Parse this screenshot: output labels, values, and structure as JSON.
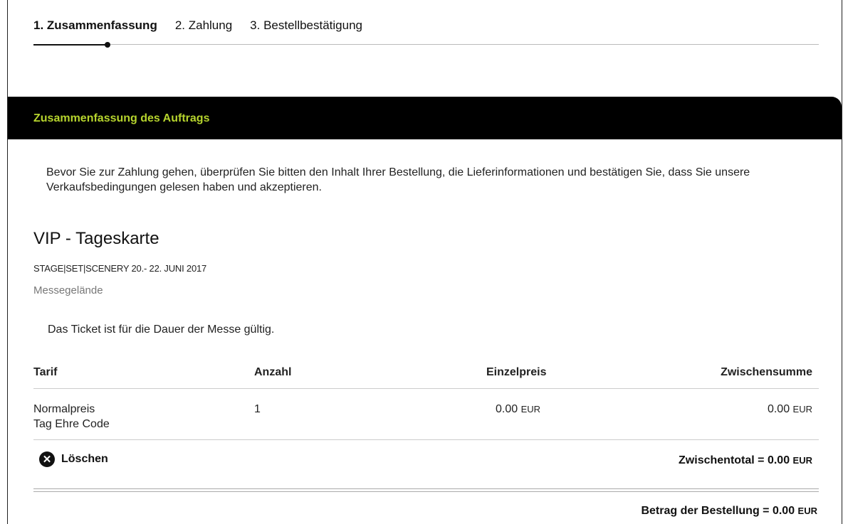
{
  "steps": [
    {
      "label": "1. Zusammenfassung"
    },
    {
      "label": "2. Zahlung"
    },
    {
      "label": "3. Bestellbestätigung"
    }
  ],
  "panel": {
    "title": "Zusammenfassung des Auftrags"
  },
  "intro": "Bevor Sie zur Zahlung gehen, überprüfen Sie bitten den Inhalt Ihrer Bestellung, die Lieferinformationen und bestätigen Sie, dass Sie unsere Verkaufsbedingungen gelesen haben und akzeptieren.",
  "product": {
    "title": "VIP - Tageskarte",
    "event": "STAGE|SET|SCENERY 20.- 22. JUNI 2017",
    "venue": "Messegelände",
    "validity": "Das Ticket ist für die Dauer der Messe gültig."
  },
  "table": {
    "headers": [
      "Tarif",
      "Anzahl",
      "Einzelpreis",
      "Zwischensumme"
    ],
    "row": {
      "tarif_line1": "Normalpreis",
      "tarif_line2": "Tag Ehre Code",
      "anzahl": "1",
      "einzelpreis": "0.00",
      "zwischensumme": "0.00",
      "currency": "EUR"
    }
  },
  "actions": {
    "delete_label": "Löschen"
  },
  "subtotal": {
    "label": "Zwischentotal = 0.00",
    "currency": "EUR"
  },
  "total": {
    "label": "Betrag der Bestellung = 0.00",
    "currency": "EUR"
  },
  "colors": {
    "accent": "#b6d42d",
    "header_bg": "#000000"
  }
}
